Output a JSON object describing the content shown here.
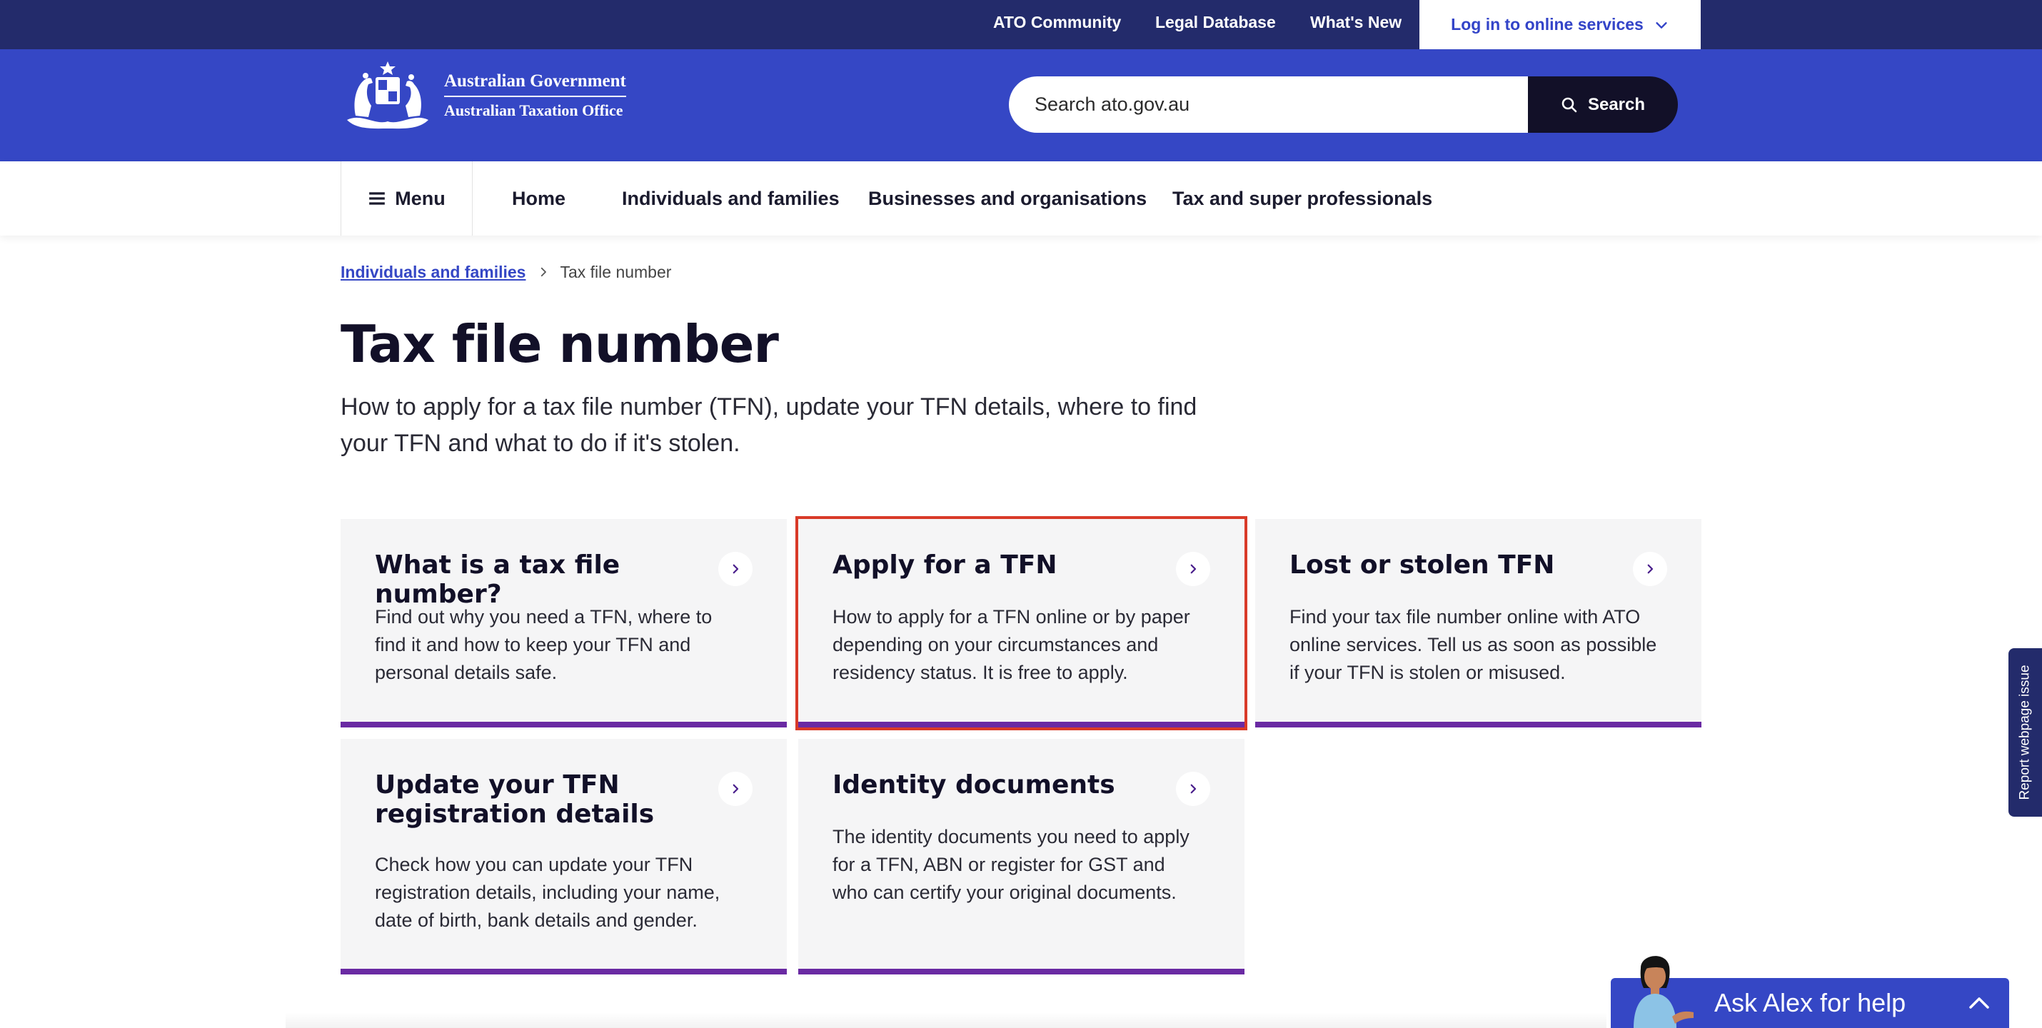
{
  "topbar": {
    "links": [
      "ATO Community",
      "Legal Database",
      "What's New"
    ],
    "login_label": "Log in to online services"
  },
  "header": {
    "logo_line1": "Australian Government",
    "logo_line2": "Australian Taxation Office",
    "search_placeholder": "Search ato.gov.au",
    "search_button": "Search"
  },
  "nav": {
    "menu_label": "Menu",
    "items": [
      "Home",
      "Individuals and families",
      "Businesses and organisations",
      "Tax and super professionals"
    ]
  },
  "breadcrumb": {
    "parent": "Individuals and families",
    "current": "Tax file number"
  },
  "page": {
    "title": "Tax file number",
    "intro": "How to apply for a tax file number (TFN), update your TFN details, where to find your TFN and what to do if it's stolen."
  },
  "cards": [
    {
      "title": "What is a tax file number?",
      "description": "Find out why you need a TFN, where to find it and how to keep your TFN and personal details safe."
    },
    {
      "title": "Apply for a TFN",
      "description": "How to apply for a TFN online or by paper depending on your circumstances and residency status. It is free to apply."
    },
    {
      "title": "Lost or stolen TFN",
      "description": "Find your tax file number online with ATO online services. Tell us as soon as possible if your TFN is stolen or misused."
    },
    {
      "title": "Update your TFN registration details",
      "description": "Check how you can update your TFN registration details, including your name, date of birth, bank details and gender."
    },
    {
      "title": "Identity documents",
      "description": "The identity documents you need to apply for a TFN, ABN or register for GST and who can certify your original documents."
    }
  ],
  "side_tab": {
    "label": "Report webpage issue"
  },
  "chat": {
    "label": "Ask Alex for help"
  },
  "colors": {
    "topbar": "#232b6b",
    "header": "#3547c5",
    "card_accent": "#6a2aa3",
    "highlight": "#d93a28"
  },
  "icons": [
    "chevron-down-icon",
    "coat-of-arms-icon",
    "search-icon",
    "hamburger-icon",
    "chevron-right-icon",
    "chevron-up-icon",
    "avatar-icon"
  ]
}
